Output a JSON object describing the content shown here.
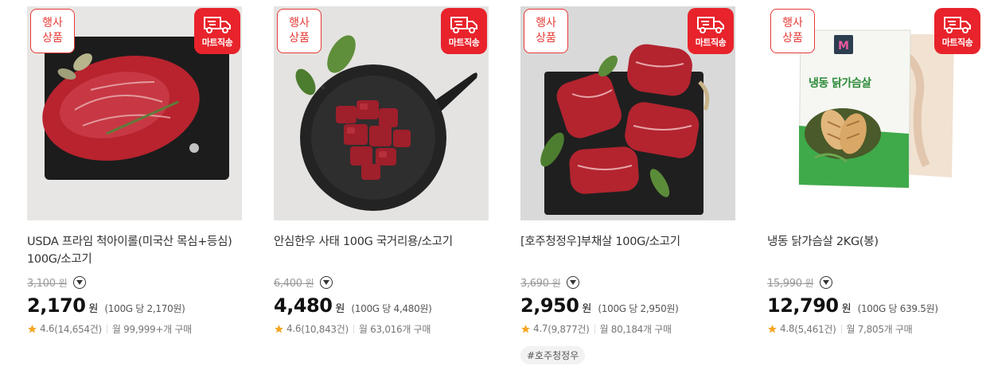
{
  "products": [
    {
      "event_badge": "행사\n상품",
      "mart_badge": "마트직송",
      "title": "USDA 프라임 척아이롤(미국산 목심+등심) 100G/소고기",
      "original_price": "3,100",
      "price": "2,170",
      "currency": "원",
      "unit_price": "(100G 당 2,170원)",
      "rating": "4.6",
      "review_count": "(14,654건)",
      "monthly_sales": "월 99,999+개 구매",
      "tag": ""
    },
    {
      "event_badge": "행사\n상품",
      "mart_badge": "마트직송",
      "title": "안심한우 사태 100G 국거리용/소고기",
      "original_price": "6,400",
      "price": "4,480",
      "currency": "원",
      "unit_price": "(100G 당 4,480원)",
      "rating": "4.6",
      "review_count": "(10,843건)",
      "monthly_sales": "월 63,016개 구매",
      "tag": ""
    },
    {
      "event_badge": "행사\n상품",
      "mart_badge": "마트직송",
      "title": "[호주청정우]부채살 100G/소고기",
      "original_price": "3,690",
      "price": "2,950",
      "currency": "원",
      "unit_price": "(100G 당 2,950원)",
      "rating": "4.7",
      "review_count": "(9,877건)",
      "monthly_sales": "월 80,184개 구매",
      "tag": "#호주청정우"
    },
    {
      "event_badge": "행사\n상품",
      "mart_badge": "마트직송",
      "title": "냉동 닭가슴살 2KG(봉)",
      "original_price": "15,990",
      "price": "12,790",
      "currency": "원",
      "unit_price": "(100G 당 639.5원)",
      "rating": "4.8",
      "review_count": "(5,461건)",
      "monthly_sales": "월 7,805개 구매",
      "tag": "",
      "package_label": "냉동 닭가슴살"
    }
  ],
  "won_small": "원",
  "colors": {
    "accent": "#e8232b",
    "star": "#f5a623"
  },
  "icons": {
    "mart": "delivery-truck-icon",
    "dropdown": "chevron-down-icon",
    "rating": "star-icon"
  }
}
